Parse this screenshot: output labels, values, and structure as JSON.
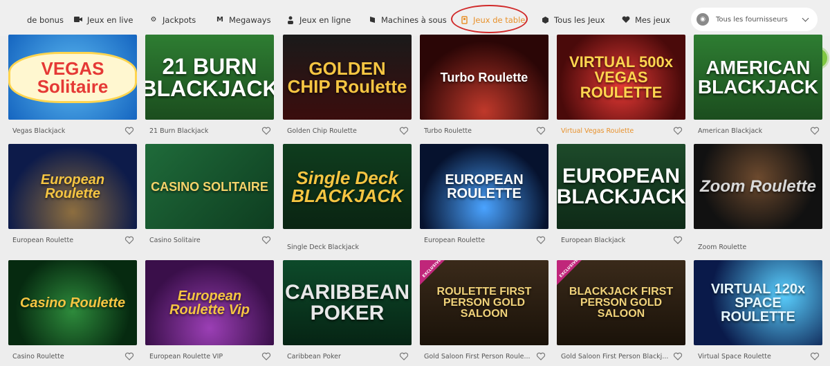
{
  "nav": {
    "items": [
      {
        "label": "de bonus",
        "icon": "bonus-icon"
      },
      {
        "label": "Jeux en live",
        "icon": "camera-icon"
      },
      {
        "label": "Jackpots",
        "icon": "gear-icon"
      },
      {
        "label": "Megaways",
        "icon": "megaways-icon"
      },
      {
        "label": "Jeux en ligne",
        "icon": "person-icon"
      },
      {
        "label": "Machines à sous",
        "icon": "slot-icon"
      },
      {
        "label": "Jeux de table",
        "icon": "table-icon"
      },
      {
        "label": "Tous les Jeux",
        "icon": "cube-icon"
      },
      {
        "label": "Mes jeux",
        "icon": "heart-icon"
      }
    ],
    "active_color": "#e8912b"
  },
  "provider_select": {
    "value": "Tous les fournisseurs"
  },
  "games": [
    {
      "title": "Vegas Blackjack",
      "art": "VEGAS Solitaire"
    },
    {
      "title": "21 Burn Blackjack",
      "art": "21 BURN BLACKJACK"
    },
    {
      "title": "Golden Chip Roulette",
      "art": "GOLDEN CHIP Roulette"
    },
    {
      "title": "Turbo Roulette",
      "art": "Turbo Roulette"
    },
    {
      "title": "Virtual Vegas Roulette",
      "art": "VIRTUAL 500x VEGAS ROULETTE"
    },
    {
      "title": "American Blackjack",
      "art": "AMERICAN BLACKJACK"
    },
    {
      "title": "European Roulette",
      "art": "European Roulette"
    },
    {
      "title": "Casino Solitaire",
      "art": "CASINO SOLITAIRE"
    },
    {
      "title": "Single Deck Blackjack",
      "art": "Single Deck BLACKJACK"
    },
    {
      "title": "European Roulette",
      "art": "EUROPEAN ROULETTE"
    },
    {
      "title": "European Blackjack",
      "art": "EUROPEAN BLACKJACK"
    },
    {
      "title": "Zoom Roulette",
      "art": "Zoom Roulette"
    },
    {
      "title": "Casino Roulette",
      "art": "Casino Roulette"
    },
    {
      "title": "European Roulette VIP",
      "art": "European Roulette Vip"
    },
    {
      "title": "Caribbean Poker",
      "art": "CARIBBEAN POKER"
    },
    {
      "title": "Gold Saloon First Person Roule...",
      "art": "ROULETTE FIRST PERSON GOLD SALOON",
      "badge": "EXCLUSIVE"
    },
    {
      "title": "Gold Saloon First Person Blackj...",
      "art": "BLACKJACK FIRST PERSON GOLD SALOON",
      "badge": "EXCLUSIVE"
    },
    {
      "title": "Virtual Space Roulette",
      "art": "VIRTUAL 120x SPACE ROULETTE"
    }
  ]
}
